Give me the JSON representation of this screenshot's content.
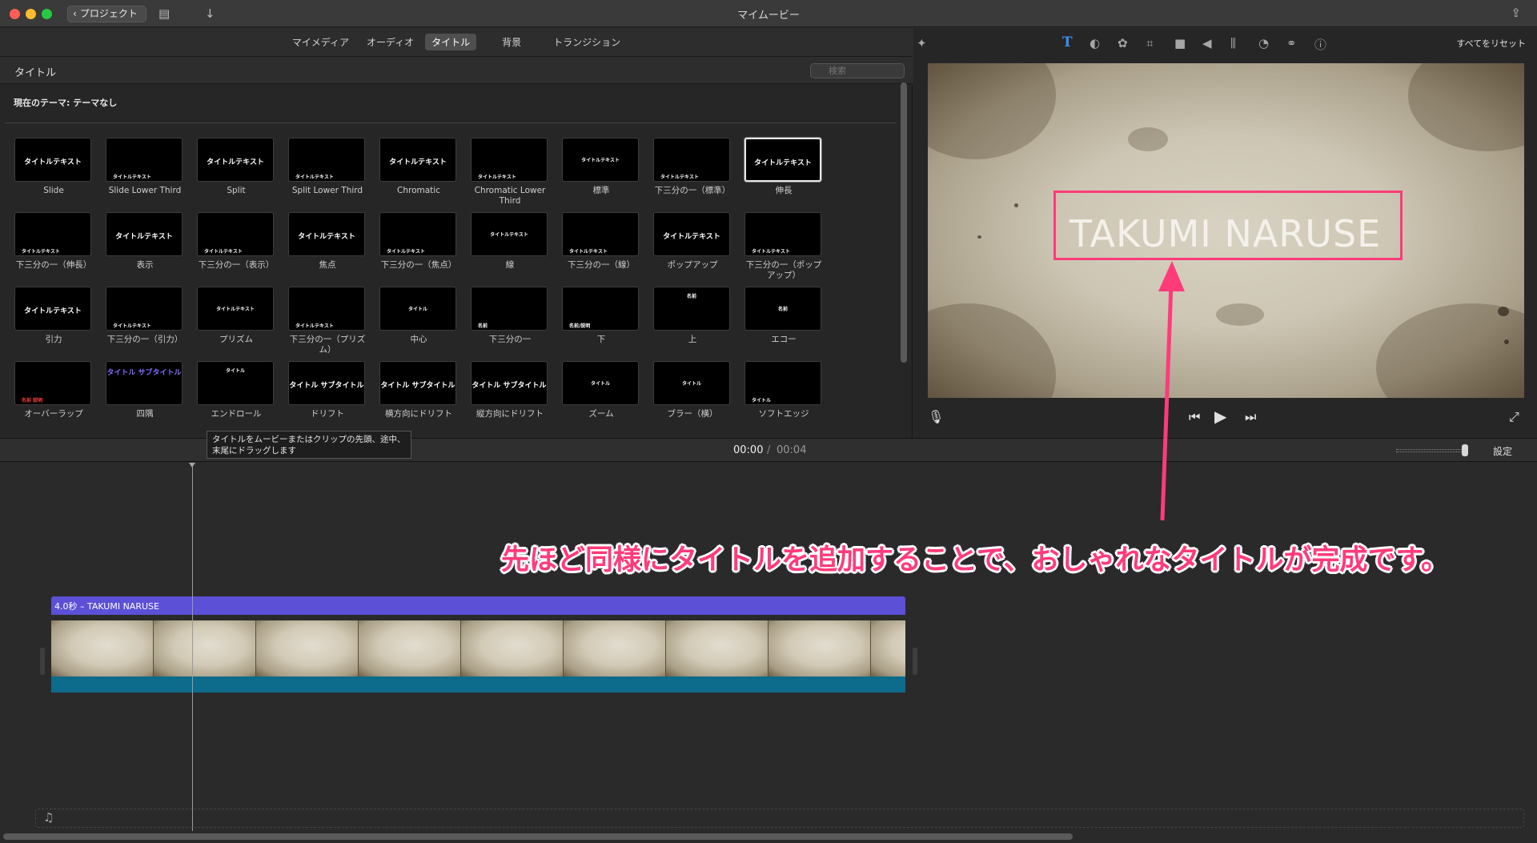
{
  "window": {
    "title": "マイムービー",
    "back_label": "プロジェクト"
  },
  "browser": {
    "tabs": [
      {
        "label": "マイメディア",
        "active": false
      },
      {
        "label": "オーディオ",
        "active": false
      },
      {
        "label": "タイトル",
        "active": true
      },
      {
        "label": "背景",
        "active": false
      },
      {
        "label": "トランジション",
        "active": false
      }
    ],
    "section_title": "タイトル",
    "search_placeholder": "検索",
    "theme_line": "現在のテーマ: テーマなし",
    "titles": [
      {
        "label": "Slide",
        "thumb": "タイトルテキスト"
      },
      {
        "label": "Slide Lower Third",
        "thumb": "タイトルテキスト"
      },
      {
        "label": "Split",
        "thumb": "タイトルテキスト"
      },
      {
        "label": "Split Lower Third",
        "thumb": "タイトルテキスト"
      },
      {
        "label": "Chromatic",
        "thumb": "タイトルテキスト"
      },
      {
        "label": "Chromatic Lower Third",
        "thumb": "タイトルテキスト"
      },
      {
        "label": "標準",
        "thumb": "タイトルテキスト"
      },
      {
        "label": "下三分の一（標準）",
        "thumb": "タイトルテキスト"
      },
      {
        "label": "伸長",
        "thumb": "タイトルテキスト"
      },
      {
        "label": "下三分の一（伸長）",
        "thumb": "タイトルテキスト"
      },
      {
        "label": "表示",
        "thumb": "タイトルテキスト"
      },
      {
        "label": "下三分の一（表示）",
        "thumb": "タイトルテキスト"
      },
      {
        "label": "焦点",
        "thumb": "タイトルテキスト"
      },
      {
        "label": "下三分の一（焦点）",
        "thumb": "タイトルテキスト"
      },
      {
        "label": "線",
        "thumb": "タイトルテキスト"
      },
      {
        "label": "下三分の一（線）",
        "thumb": "タイトルテキスト"
      },
      {
        "label": "ポップアップ",
        "thumb": "タイトルテキスト"
      },
      {
        "label": "下三分の一（ポップアップ）",
        "thumb": "タイトルテキスト"
      },
      {
        "label": "引力",
        "thumb": "タイトルテキスト"
      },
      {
        "label": "下三分の一（引力）",
        "thumb": "タイトルテキスト"
      },
      {
        "label": "プリズム",
        "thumb": "タイトルテキスト"
      },
      {
        "label": "下三分の一（プリズム）",
        "thumb": "タイトルテキスト"
      },
      {
        "label": "中心",
        "thumb": "タイトル"
      },
      {
        "label": "下三分の一",
        "thumb": "名前"
      },
      {
        "label": "下",
        "thumb": "名前/説明"
      },
      {
        "label": "上",
        "thumb": "名前"
      },
      {
        "label": "エコー",
        "thumb": "名前"
      },
      {
        "label": "オーバーラップ",
        "thumb": "名前 説明"
      },
      {
        "label": "四隅",
        "thumb": "タイトル サブタイトル"
      },
      {
        "label": "エンドロール",
        "thumb": "タイトル"
      },
      {
        "label": "ドリフト",
        "thumb": "タイトル サブタイトル"
      },
      {
        "label": "横方向にドリフト",
        "thumb": "タイトル サブタイトル"
      },
      {
        "label": "縦方向にドリフト",
        "thumb": "タイトル サブタイトル"
      },
      {
        "label": "ズーム",
        "thumb": "タイトル"
      },
      {
        "label": "ブラー（横）",
        "thumb": "タイトル"
      },
      {
        "label": "ソフトエッジ",
        "thumb": "タイトル"
      }
    ],
    "tooltip": "タイトルをムービーまたはクリップの先頭、途中、末尾にドラッグします"
  },
  "viewer": {
    "reset_label": "すべてをリセット",
    "preview_title": "TAKUMI NARUSE"
  },
  "timebar": {
    "current": "00:00",
    "separator": "/",
    "total": "00:04",
    "settings_label": "設定"
  },
  "timeline": {
    "title_clip_label": "4.0秒 – TAKUMI NARUSE",
    "frame_count": 9
  },
  "annotation": {
    "text": "先ほど同様にタイトルを追加することで、おしゃれなタイトルが完成です。",
    "color": "#ff3b7a"
  }
}
